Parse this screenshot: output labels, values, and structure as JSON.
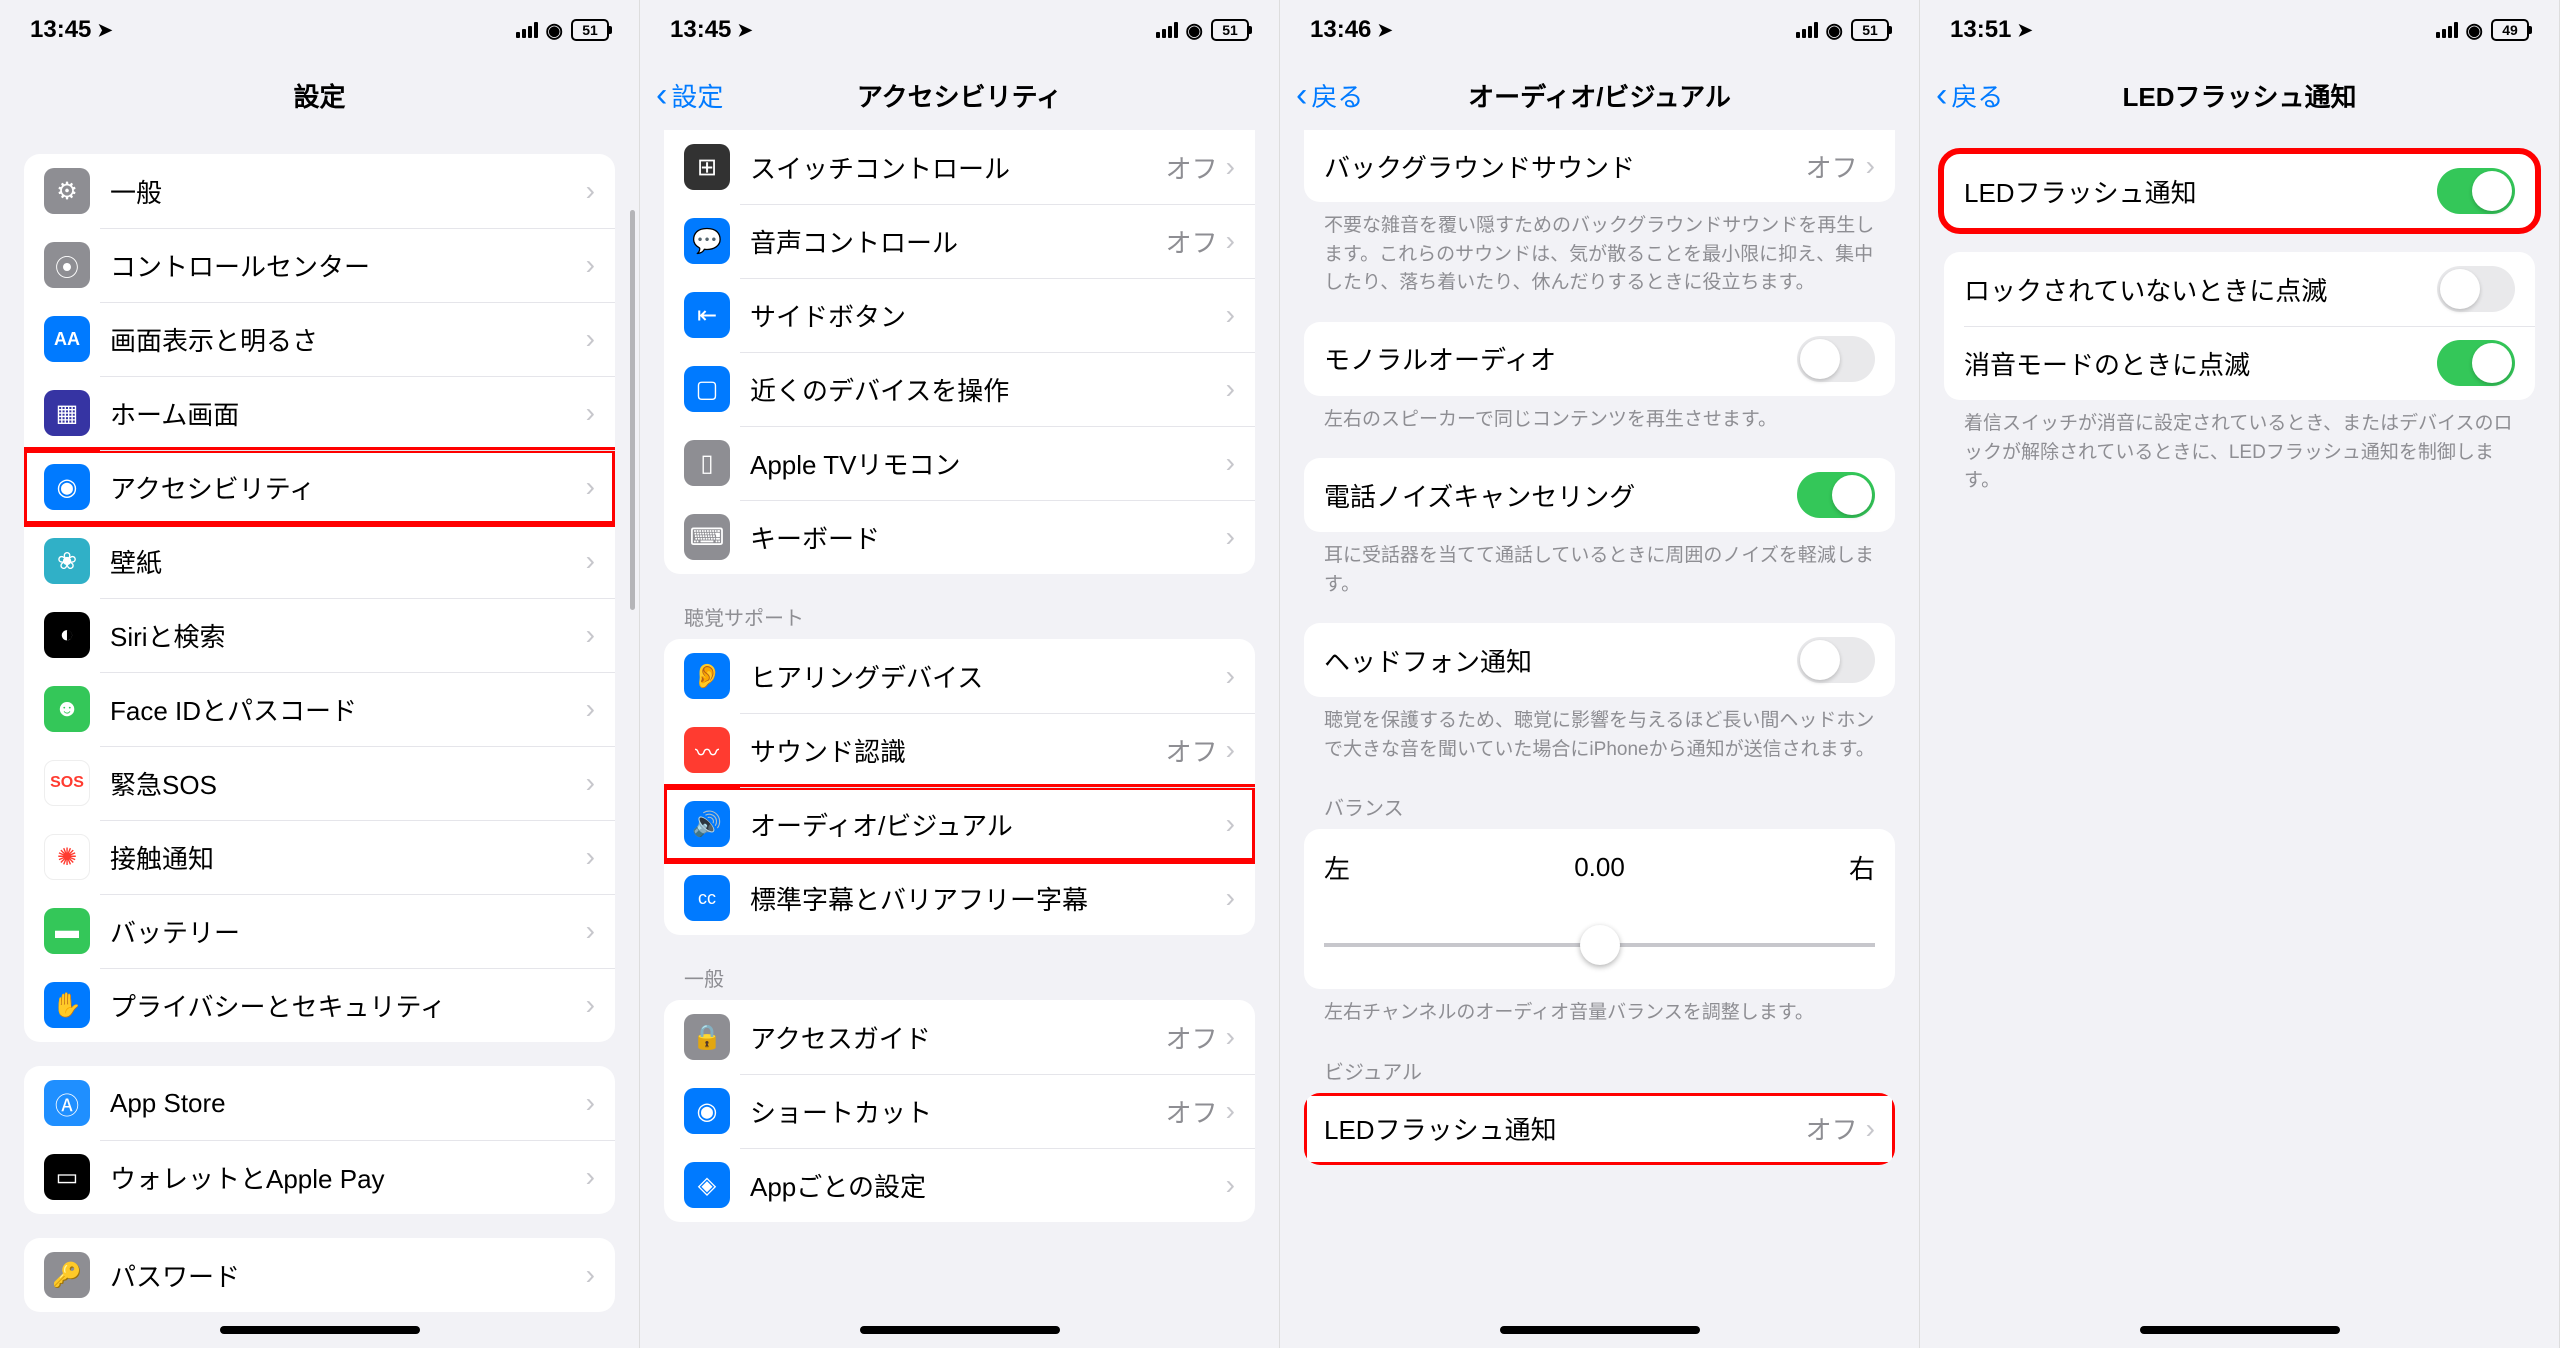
{
  "screens": [
    {
      "status": {
        "time": "13:45",
        "battery": "51"
      },
      "nav": {
        "title": "設定",
        "back": null
      },
      "groups": [
        {
          "rows": [
            {
              "icon_bg": "#8e8e93",
              "icon": "⚙",
              "label": "一般"
            },
            {
              "icon_bg": "#8e8e93",
              "icon": "⦿",
              "label": "コントロールセンター"
            },
            {
              "icon_bg": "#007aff",
              "icon": "AA",
              "label": "画面表示と明るさ"
            },
            {
              "icon_bg": "#3a3a8f",
              "icon": "▦",
              "label": "ホーム画面"
            },
            {
              "icon_bg": "#007aff",
              "icon": "◉",
              "label": "アクセシビリティ",
              "hl": true
            },
            {
              "icon_bg": "#30b0c7",
              "icon": "❀",
              "label": "壁紙"
            },
            {
              "icon_bg": "#000000",
              "icon": "◐",
              "label": "Siriと検索"
            },
            {
              "icon_bg": "#34c759",
              "icon": "☻",
              "label": "Face IDとパスコード"
            },
            {
              "icon_bg": "#ff3b30",
              "icon_txt": "SOS",
              "label": "緊急SOS"
            },
            {
              "icon_bg": "#ffffff",
              "icon": "☀",
              "icon_fg": "#ff3b30",
              "label": "接触通知"
            },
            {
              "icon_bg": "#34c759",
              "icon": "▬",
              "label": "バッテリー"
            },
            {
              "icon_bg": "#007aff",
              "icon": "✋",
              "label": "プライバシーとセキュリティ"
            }
          ]
        },
        {
          "rows": [
            {
              "icon_bg": "#1f8fff",
              "icon": "A",
              "label": "App Store"
            },
            {
              "icon_bg": "#000000",
              "icon": "▭",
              "label": "ウォレットとApple Pay"
            }
          ]
        },
        {
          "rows": [
            {
              "icon_bg": "#8e8e93",
              "icon": "🔑",
              "label": "パスワード"
            }
          ]
        }
      ]
    },
    {
      "status": {
        "time": "13:45",
        "battery": "51"
      },
      "nav": {
        "title": "アクセシビリティ",
        "back": "設定"
      },
      "groups": [
        {
          "rows": [
            {
              "icon_bg": "#323232",
              "icon": "⊞",
              "label": "スイッチコントロール",
              "value": "オフ"
            },
            {
              "icon_bg": "#007aff",
              "icon": "💬",
              "label": "音声コントロール",
              "value": "オフ"
            },
            {
              "icon_bg": "#007aff",
              "icon": "⇤",
              "label": "サイドボタン"
            },
            {
              "icon_bg": "#007aff",
              "icon": "▢",
              "label": "近くのデバイスを操作"
            },
            {
              "icon_bg": "#8e8e93",
              "icon": "▯",
              "label": "Apple TVリモコン"
            },
            {
              "icon_bg": "#8e8e93",
              "icon": "⌨",
              "label": "キーボード"
            }
          ]
        },
        {
          "header": "聴覚サポート",
          "rows": [
            {
              "icon_bg": "#007aff",
              "icon": "👂",
              "label": "ヒアリングデバイス"
            },
            {
              "icon_bg": "#ff3b30",
              "icon": "〰",
              "label": "サウンド認識",
              "value": "オフ"
            },
            {
              "icon_bg": "#007aff",
              "icon": "🔊",
              "label": "オーディオ/ビジュアル",
              "hl": true
            },
            {
              "icon_bg": "#007aff",
              "icon": "㏄",
              "label": "標準字幕とバリアフリー字幕"
            }
          ]
        },
        {
          "header": "一般",
          "rows": [
            {
              "icon_bg": "#8e8e93",
              "icon": "🔒",
              "label": "アクセスガイド",
              "value": "オフ"
            },
            {
              "icon_bg": "#007aff",
              "icon": "◉",
              "label": "ショートカット",
              "value": "オフ"
            },
            {
              "icon_bg": "#007aff",
              "icon": "◈",
              "label": "Appごとの設定"
            }
          ]
        }
      ]
    },
    {
      "status": {
        "time": "13:46",
        "battery": "51"
      },
      "nav": {
        "title": "オーディオ/ビジュアル",
        "back": "戻る"
      },
      "groups": [
        {
          "rows": [
            {
              "no_icon": true,
              "label": "バックグラウンドサウンド",
              "value": "オフ"
            }
          ],
          "footer": "不要な雑音を覆い隠すためのバックグラウンドサウンドを再生します。これらのサウンドは、気が散ることを最小限に抑え、集中したり、落ち着いたり、休んだりするときに役立ちます。"
        },
        {
          "rows": [
            {
              "no_icon": true,
              "label": "モノラルオーディオ",
              "toggle": "off"
            }
          ],
          "footer": "左右のスピーカーで同じコンテンツを再生させます。"
        },
        {
          "rows": [
            {
              "no_icon": true,
              "label": "電話ノイズキャンセリング",
              "toggle": "on"
            }
          ],
          "footer": "耳に受話器を当てて通話しているときに周囲のノイズを軽減します。"
        },
        {
          "rows": [
            {
              "no_icon": true,
              "label": "ヘッドフォン通知",
              "toggle": "off"
            }
          ],
          "footer": "聴覚を保護するため、聴覚に影響を与えるほど長い間ヘッドホンで大きな音を聞いていた場合にiPhoneから通知が送信されます。"
        },
        {
          "header": "バランス",
          "slider": {
            "left": "左",
            "value": "0.00",
            "right": "右"
          },
          "footer": "左右チャンネルのオーディオ音量バランスを調整します。"
        },
        {
          "header": "ビジュアル",
          "rows": [
            {
              "no_icon": true,
              "label": "LEDフラッシュ通知",
              "value": "オフ",
              "hl": true
            }
          ]
        }
      ]
    },
    {
      "status": {
        "time": "13:51",
        "battery": "49"
      },
      "nav": {
        "title": "LEDフラッシュ通知",
        "back": "戻る"
      },
      "groups": [
        {
          "hl_group": true,
          "rows": [
            {
              "no_icon": true,
              "label": "LEDフラッシュ通知",
              "toggle": "on"
            }
          ]
        },
        {
          "rows": [
            {
              "no_icon": true,
              "label": "ロックされていないときに点滅",
              "toggle": "off"
            },
            {
              "no_icon": true,
              "label": "消音モードのときに点滅",
              "toggle": "on"
            }
          ],
          "footer": "着信スイッチが消音に設定されているとき、またはデバイスのロックが解除されているときに、LEDフラッシュ通知を制御します。"
        }
      ]
    }
  ]
}
